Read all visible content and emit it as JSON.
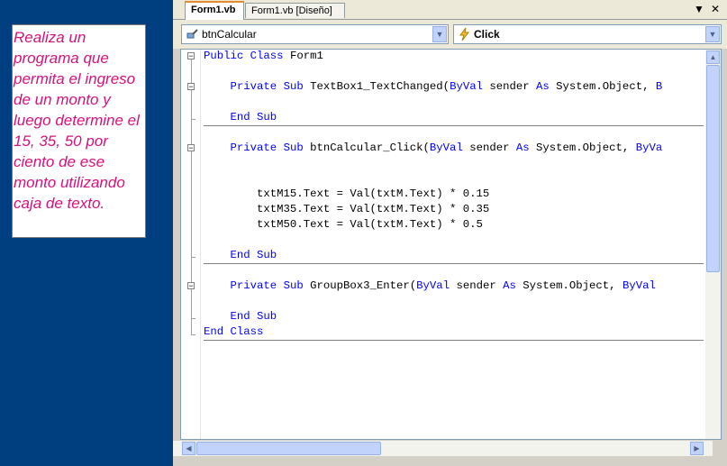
{
  "instruction": {
    "text": "Realiza un programa que permita el ingreso de un monto y luego determine el 15, 35, 50 por ciento de ese monto utilizando caja de texto."
  },
  "tabs": [
    {
      "label": "Form1.vb",
      "active": true
    },
    {
      "label": "Form1.vb [Diseño]",
      "active": false
    }
  ],
  "window_buttons": {
    "dropdown": "▼",
    "close": "✕"
  },
  "object_combo": {
    "icon": "component-icon",
    "value": "btnCalcular"
  },
  "event_combo": {
    "icon": "lightning-icon",
    "value": "Click"
  },
  "code_lines": [
    [
      [
        "kw",
        "Public Class "
      ],
      [
        "t",
        "Form1"
      ]
    ],
    [],
    [
      [
        "t",
        "    "
      ],
      [
        "kw",
        "Private Sub "
      ],
      [
        "t",
        "TextBox1_TextChanged("
      ],
      [
        "kw",
        "ByVal "
      ],
      [
        "t",
        "sender "
      ],
      [
        "kw",
        "As "
      ],
      [
        "t",
        "System.Object, "
      ],
      [
        "kw",
        "B"
      ]
    ],
    [],
    [
      [
        "t",
        "    "
      ],
      [
        "kw",
        "End Sub"
      ]
    ],
    [],
    [
      [
        "t",
        "    "
      ],
      [
        "kw",
        "Private Sub "
      ],
      [
        "t",
        "btnCalcular_Click("
      ],
      [
        "kw",
        "ByVal "
      ],
      [
        "t",
        "sender "
      ],
      [
        "kw",
        "As "
      ],
      [
        "t",
        "System.Object, "
      ],
      [
        "kw",
        "ByVa"
      ]
    ],
    [],
    [],
    [
      [
        "t",
        "        txtM15.Text = Val(txtM.Text) * 0.15"
      ]
    ],
    [
      [
        "t",
        "        txtM35.Text = Val(txtM.Text) * 0.35"
      ]
    ],
    [
      [
        "t",
        "        txtM50.Text = Val(txtM.Text) * 0.5"
      ]
    ],
    [],
    [
      [
        "t",
        "    "
      ],
      [
        "kw",
        "End Sub"
      ]
    ],
    [],
    [
      [
        "t",
        "    "
      ],
      [
        "kw",
        "Private Sub "
      ],
      [
        "t",
        "GroupBox3_Enter("
      ],
      [
        "kw",
        "ByVal "
      ],
      [
        "t",
        "sender "
      ],
      [
        "kw",
        "As "
      ],
      [
        "t",
        "System.Object, "
      ],
      [
        "kw",
        "ByVal"
      ]
    ],
    [],
    [
      [
        "t",
        "    "
      ],
      [
        "kw",
        "End Sub"
      ]
    ],
    [
      [
        "kw",
        "End Class"
      ]
    ]
  ],
  "colors": {
    "keyword": "#0000ff",
    "instruction_text": "#d6127a",
    "background": "#003f7f"
  }
}
